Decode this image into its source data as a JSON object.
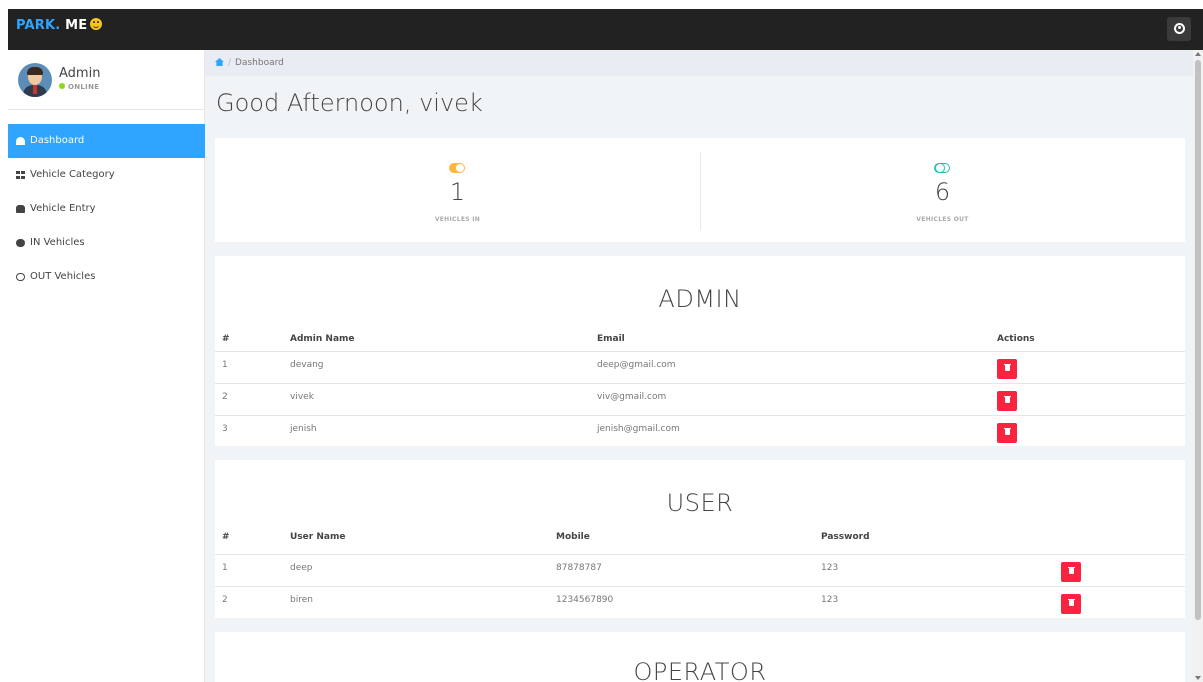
{
  "brand": {
    "part1": "PARK.",
    "part2": " ME"
  },
  "colors": {
    "primary": "#30a5ff",
    "topbar": "#222222",
    "orange": "#ffb53e",
    "teal": "#1ebfae",
    "danger": "#f9243f",
    "online": "#8ad919"
  },
  "profile": {
    "name": "Admin",
    "status": "ONLINE"
  },
  "sidebar": {
    "items": [
      {
        "label": "Dashboard",
        "icon": "dashboard-icon"
      },
      {
        "label": "Vehicle Category",
        "icon": "grid-icon"
      },
      {
        "label": "Vehicle Entry",
        "icon": "car-icon"
      },
      {
        "label": "IN Vehicles",
        "icon": "toggle-on-icon"
      },
      {
        "label": "OUT Vehicles",
        "icon": "toggle-off-icon"
      }
    ]
  },
  "breadcrumb": {
    "current": "Dashboard"
  },
  "page_title": "Good Afternoon, vivek",
  "stats": {
    "in": {
      "value": "1",
      "label": "VEHICLES IN"
    },
    "out": {
      "value": "6",
      "label": "VEHICLES OUT"
    }
  },
  "admin_table": {
    "title": "ADMIN",
    "headers": [
      "#",
      "Admin Name",
      "Email",
      "Actions"
    ],
    "rows": [
      {
        "num": "1",
        "name": "devang",
        "email": "deep@gmail.com"
      },
      {
        "num": "2",
        "name": "vivek",
        "email": "viv@gmail.com"
      },
      {
        "num": "3",
        "name": "jenish",
        "email": "jenish@gmail.com"
      }
    ]
  },
  "user_table": {
    "title": "USER",
    "headers": [
      "#",
      "User Name",
      "Mobile",
      "Password"
    ],
    "rows": [
      {
        "num": "1",
        "name": "deep",
        "mobile": "87878787",
        "password": "123"
      },
      {
        "num": "2",
        "name": "biren",
        "mobile": "1234567890",
        "password": "123"
      }
    ]
  },
  "operator_table": {
    "title": "OPERATOR"
  }
}
